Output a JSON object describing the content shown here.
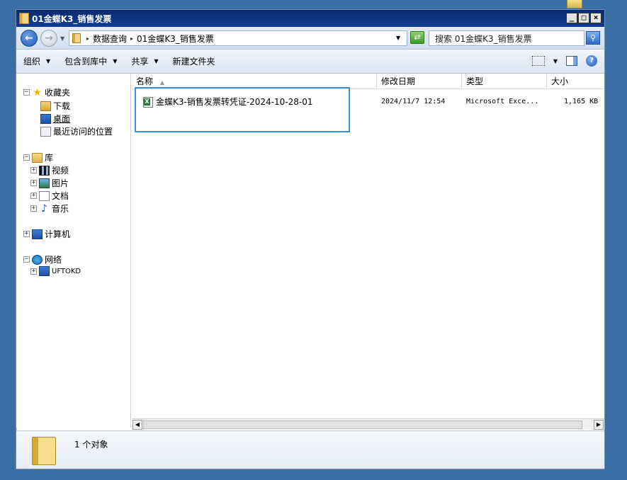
{
  "window": {
    "title": "01金蝶K3_销售发票"
  },
  "titlebar": {
    "min": "_",
    "max": "□",
    "close": "×"
  },
  "address": {
    "crumbs": [
      "数据查询",
      "01金蝶K3_销售发票"
    ],
    "search_placeholder": "搜索 01金蝶K3_销售发票"
  },
  "toolbar": {
    "organize": "组织",
    "include_in_library": "包含到库中",
    "share": "共享",
    "new_folder": "新建文件夹"
  },
  "nav": {
    "favorites": "收藏夹",
    "downloads": "下载",
    "desktop": "桌面",
    "recent": "最近访问的位置",
    "libraries": "库",
    "videos": "视频",
    "pictures": "图片",
    "documents": "文档",
    "music": "音乐",
    "computer": "计算机",
    "network": "网络",
    "network_host": "UFTOKD"
  },
  "columns": {
    "name": "名称",
    "modified": "修改日期",
    "type": "类型",
    "size": "大小"
  },
  "files": [
    {
      "name": "金蝶K3-销售发票转凭证-2024-10-28-01",
      "modified": "2024/11/7 12:54",
      "type": "Microsoft Exce...",
      "size": "1,165 KB"
    }
  ],
  "status": {
    "count": "1 个对象"
  },
  "colors": {
    "title_bar": "#0a2a6e",
    "desktop": "#3a6ea5",
    "selection": "#3c8ee0"
  }
}
